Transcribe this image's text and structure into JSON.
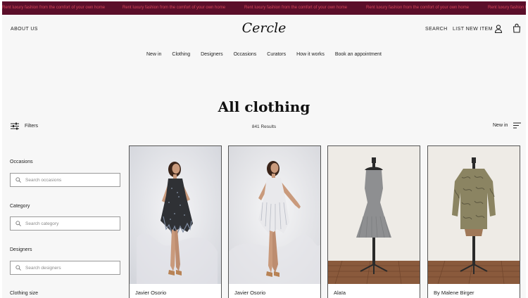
{
  "promo": {
    "messages": [
      "Rent luxury fashion from the comfort of your own home",
      "Rent luxury fashion from the comfort of your own home",
      "Rent luxury fashion from the comfort of your own home",
      "Rent luxury fashion from the comfort of your own home",
      "Rent luxury fashion from the comfort of your own home"
    ],
    "background": "#5b0f2a",
    "text_color": "#d9475c"
  },
  "header": {
    "about": "ABOUT US",
    "logo": "Cercle",
    "search": "SEARCH",
    "list_item": "LIST NEW ITEM",
    "icons": [
      "user-icon",
      "shopping-bag-icon"
    ]
  },
  "nav": {
    "items": [
      "New in",
      "Clothing",
      "Designers",
      "Occasions",
      "Curators",
      "How it works",
      "Book an appointment"
    ]
  },
  "page": {
    "title": "All clothing"
  },
  "toolbar": {
    "filters_label": "Filters",
    "results": "841 Results",
    "sort_label": "New in"
  },
  "sidebar": {
    "facets": [
      {
        "label": "Occasions",
        "placeholder": "Search occasions"
      },
      {
        "label": "Category",
        "placeholder": "Search category"
      },
      {
        "label": "Designers",
        "placeholder": "Search designers"
      },
      {
        "label": "Clothing size"
      }
    ]
  },
  "products": [
    {
      "designer": "Javier Osorio",
      "image": "model in black sequin fringe dress"
    },
    {
      "designer": "Javier Osorio",
      "image": "model in silver fringe dress"
    },
    {
      "designer": "Alaïa",
      "image": "grey knit dress on mannequin"
    },
    {
      "designer": "By Malene Birger",
      "image": "printed blouse on mannequin"
    }
  ]
}
